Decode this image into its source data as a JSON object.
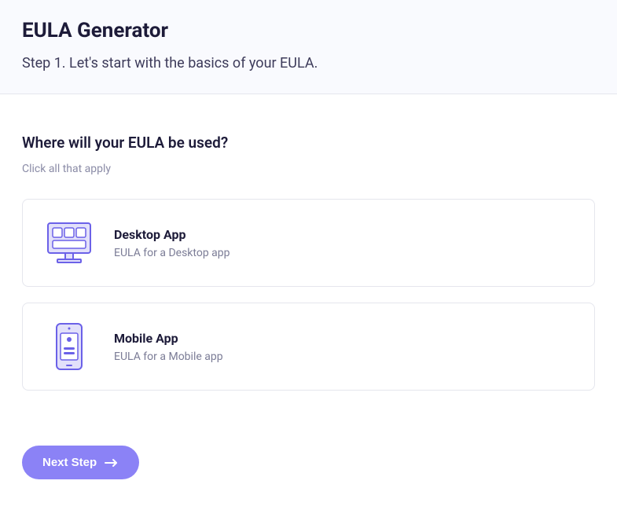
{
  "header": {
    "title": "EULA Generator",
    "step_text": "Step 1. Let's start with the basics of your EULA."
  },
  "main": {
    "question": "Where will your EULA be used?",
    "hint": "Click all that apply",
    "options": [
      {
        "title": "Desktop App",
        "desc": "EULA for a Desktop app",
        "icon": "desktop-app-icon"
      },
      {
        "title": "Mobile App",
        "desc": "EULA for a Mobile app",
        "icon": "mobile-app-icon"
      }
    ],
    "next_button": "Next Step"
  },
  "colors": {
    "accent": "#8b82f6",
    "heading": "#1d1b39",
    "muted": "#8a8ba6",
    "border": "#e5e6ed",
    "header_bg": "#f9fafe"
  }
}
